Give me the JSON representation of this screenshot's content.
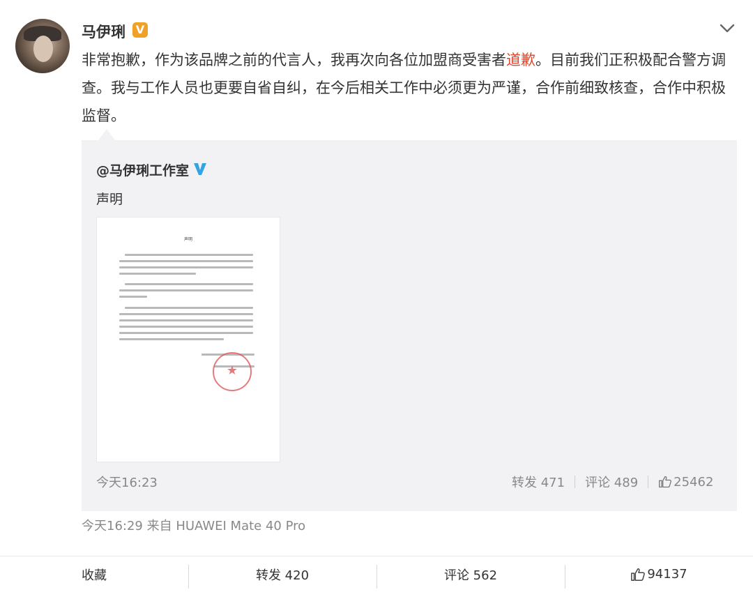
{
  "post": {
    "username": "马伊琍",
    "text_part1": "非常抱歉，作为该品牌之前的代言人，我再次向各位加盟商受害者",
    "text_highlight": "道歉",
    "text_part2": "。目前我们正积极配合警方调查。我与工作人员也更要自省自纠，在今后相关工作中必须更为严谨，合作前细致核查，合作中积极监督。",
    "meta": "今天16:29  来自 HUAWEI Mate 40 Pro"
  },
  "repost": {
    "username": "@马伊琍工作室",
    "text": "声明",
    "time": "今天16:23",
    "forward_label": "转发 471",
    "comment_label": "评论 489",
    "like_count": "25462",
    "document": {
      "title": "声明"
    }
  },
  "actions": {
    "favorite": "收藏",
    "forward": "转发 420",
    "comment": "评论 562",
    "like": "94137"
  },
  "colors": {
    "highlight": "#e0452b",
    "verified_orange": "#f0a227",
    "verified_blue": "#35a3e0",
    "repost_bg": "#f2f2f5"
  },
  "icons": [
    "chevron-down-icon",
    "verified-badge-icon",
    "verified-blue-icon",
    "thumbs-up-icon"
  ]
}
